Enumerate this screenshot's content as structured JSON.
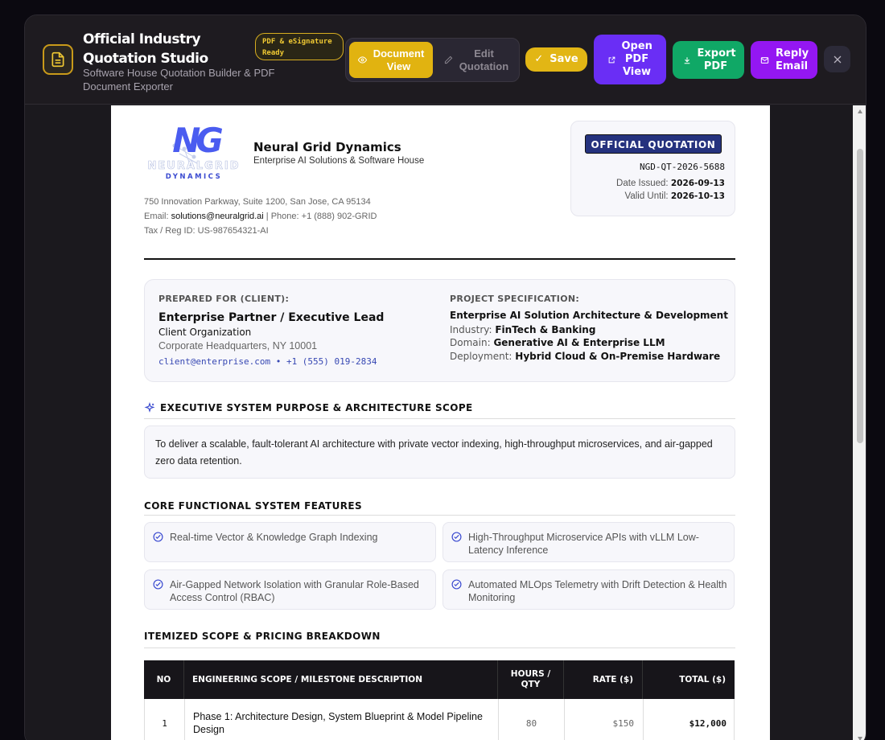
{
  "app": {
    "title": "Official Industry Quotation Studio",
    "subtitle": "Software House Quotation Builder & PDF Document Exporter",
    "badge": "PDF & eSignature Ready"
  },
  "toolbar": {
    "document_view": "Document View",
    "edit_quotation": "Edit Quotation",
    "save": "Save",
    "open_pdf": "Open PDF View",
    "export_pdf": "Export PDF",
    "reply_email": "Reply Email"
  },
  "company": {
    "logo_initials": "NG",
    "logo_line1": "NEURALGRID",
    "logo_line2": "DYNAMICS",
    "name": "Neural Grid Dynamics",
    "tagline": "Enterprise AI Solutions & Software House",
    "address": "750 Innovation Parkway, Suite 1200, San Jose, CA 95134",
    "email_label": "Email:",
    "email": "solutions@neuralgrid.ai",
    "phone_sep": " | Phone: ",
    "phone": "+1 (888) 902-GRID",
    "tax": "Tax / Reg ID: US-987654321-AI"
  },
  "quote": {
    "label": "OFFICIAL QUOTATION",
    "number": "NGD-QT-2026-5688",
    "issued_label": "Date Issued:",
    "issued": "2026-09-13",
    "valid_label": "Valid Until:",
    "valid": "2026-10-13"
  },
  "client": {
    "heading": "PREPARED FOR (CLIENT):",
    "name": "Enterprise Partner / Executive Lead",
    "org": "Client Organization",
    "address": "Corporate Headquarters, NY 10001",
    "contact": "client@enterprise.com • +1 (555) 019-2834"
  },
  "project": {
    "heading": "PROJECT SPECIFICATION:",
    "title": "Enterprise AI Solution Architecture & Development",
    "industry_label": "Industry:",
    "industry": "FinTech & Banking",
    "domain_label": "Domain:",
    "domain": "Generative AI & Enterprise LLM",
    "deployment_label": "Deployment:",
    "deployment": "Hybrid Cloud & On-Premise Hardware"
  },
  "purpose": {
    "heading": "EXECUTIVE SYSTEM PURPOSE & ARCHITECTURE SCOPE",
    "text": "To deliver a scalable, fault-tolerant AI architecture with private vector indexing, high-throughput microservices, and air-gapped zero data retention."
  },
  "features": {
    "heading": "CORE FUNCTIONAL SYSTEM FEATURES",
    "items": [
      "Real-time Vector & Knowledge Graph Indexing",
      "High-Throughput Microservice APIs with vLLM Low-Latency Inference",
      "Air-Gapped Network Isolation with Granular Role-Based Access Control (RBAC)",
      "Automated MLOps Telemetry with Drift Detection & Health Monitoring"
    ]
  },
  "pricing": {
    "heading": "ITEMIZED SCOPE & PRICING BREAKDOWN",
    "columns": [
      "NO",
      "ENGINEERING SCOPE / MILESTONE DESCRIPTION",
      "HOURS / QTY",
      "RATE ($)",
      "TOTAL ($)"
    ],
    "rows": [
      {
        "no": "1",
        "desc": "Phase 1: Architecture Design, System Blueprint & Model Pipeline Design",
        "hours": "80",
        "rate": "$150",
        "total": "$12,000"
      }
    ]
  },
  "colors": {
    "accent_gold": "#e1b310",
    "accent_purple": "#6a2ef5",
    "accent_green": "#10a866",
    "accent_magenta": "#9417f2",
    "navy": "#25327e"
  }
}
